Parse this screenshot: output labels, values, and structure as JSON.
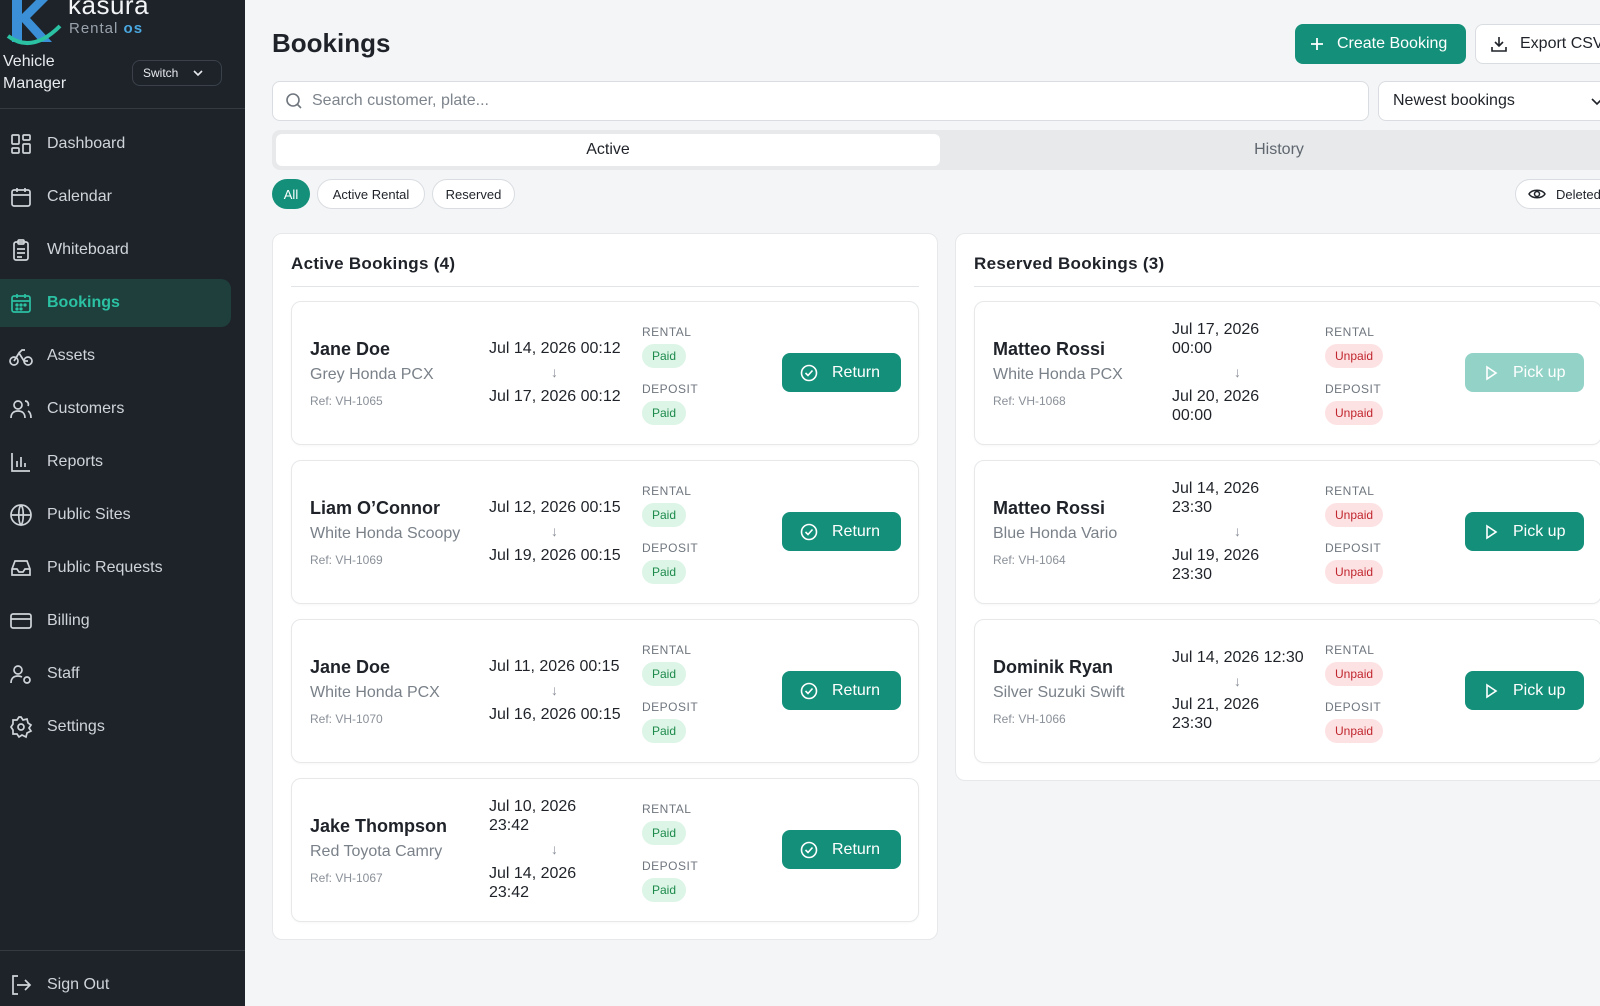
{
  "brand": {
    "name": "kasura",
    "sub_prefix": "Rental",
    "sub_suffix": "os"
  },
  "sidebar": {
    "manager_title": "Vehicle Manager",
    "switch_label": "Switch",
    "items": [
      {
        "label": "Dashboard",
        "icon": "dashboard-icon"
      },
      {
        "label": "Calendar",
        "icon": "calendar-icon"
      },
      {
        "label": "Whiteboard",
        "icon": "clipboard-icon"
      },
      {
        "label": "Bookings",
        "icon": "calendar-grid-icon",
        "active": true
      },
      {
        "label": "Assets",
        "icon": "bike-icon"
      },
      {
        "label": "Customers",
        "icon": "users-icon"
      },
      {
        "label": "Reports",
        "icon": "bar-chart-icon"
      },
      {
        "label": "Public Sites",
        "icon": "globe-icon"
      },
      {
        "label": "Public Requests",
        "icon": "inbox-icon"
      },
      {
        "label": "Billing",
        "icon": "credit-card-icon"
      },
      {
        "label": "Staff",
        "icon": "user-cog-icon"
      },
      {
        "label": "Settings",
        "icon": "gear-icon"
      }
    ],
    "signout_label": "Sign Out"
  },
  "header": {
    "title": "Bookings",
    "create_label": "Create Booking",
    "export_label": "Export CSV"
  },
  "search": {
    "placeholder": "Search customer, plate...",
    "value": ""
  },
  "sort": {
    "selected": "Newest bookings"
  },
  "tabs": [
    {
      "label": "Active",
      "selected": true
    },
    {
      "label": "History",
      "selected": false
    }
  ],
  "filters": [
    {
      "label": "All",
      "selected": true
    },
    {
      "label": "Active Rental",
      "selected": false
    },
    {
      "label": "Reserved",
      "selected": false
    }
  ],
  "deleted_label": "Deleted",
  "colors": {
    "accent": "#14907a",
    "sidebar_bg": "#1e232a",
    "paid_bg": "#dcf5e6",
    "unpaid_bg": "#fde2e4"
  },
  "active_panel": {
    "title": "Active Bookings (4)",
    "rental_label": "RENTAL",
    "deposit_label": "DEPOSIT",
    "action_label": "Return",
    "bookings": [
      {
        "name": "Jane Doe",
        "vehicle": "Grey Honda PCX",
        "ref": "Ref: VH-1065",
        "start": "Jul 14, 2026 00:12",
        "end": "Jul 17, 2026 00:12",
        "rental": "Paid",
        "deposit": "Paid"
      },
      {
        "name": "Liam O’Connor",
        "vehicle": "White Honda Scoopy",
        "ref": "Ref: VH-1069",
        "start": "Jul 12, 2026 00:15",
        "end": "Jul 19, 2026 00:15",
        "rental": "Paid",
        "deposit": "Paid"
      },
      {
        "name": "Jane Doe",
        "vehicle": "White Honda PCX",
        "ref": "Ref: VH-1070",
        "start": "Jul 11, 2026 00:15",
        "end": "Jul 16, 2026 00:15",
        "rental": "Paid",
        "deposit": "Paid"
      },
      {
        "name": "Jake Thompson",
        "vehicle": "Red Toyota Camry",
        "ref": "Ref: VH-1067",
        "start": "Jul 10, 2026 23:42",
        "end": "Jul 14, 2026 23:42",
        "rental": "Paid",
        "deposit": "Paid"
      }
    ]
  },
  "reserved_panel": {
    "title": "Reserved Bookings (3)",
    "rental_label": "RENTAL",
    "deposit_label": "DEPOSIT",
    "action_label": "Pick up",
    "bookings": [
      {
        "name": "Matteo Rossi",
        "vehicle": "White Honda PCX",
        "ref": "Ref: VH-1068",
        "start": "Jul 17, 2026 00:00",
        "end": "Jul 20, 2026 00:00",
        "rental": "Unpaid",
        "deposit": "Unpaid",
        "action_disabled": true
      },
      {
        "name": "Matteo Rossi",
        "vehicle": "Blue Honda Vario",
        "ref": "Ref: VH-1064",
        "start": "Jul 14, 2026 23:30",
        "end": "Jul 19, 2026 23:30",
        "rental": "Unpaid",
        "deposit": "Unpaid",
        "action_disabled": false
      },
      {
        "name": "Dominik Ryan",
        "vehicle": "Silver Suzuki Swift",
        "ref": "Ref: VH-1066",
        "start": "Jul 14, 2026 12:30",
        "end": "Jul 21, 2026 23:30",
        "rental": "Unpaid",
        "deposit": "Unpaid",
        "action_disabled": false
      }
    ]
  }
}
